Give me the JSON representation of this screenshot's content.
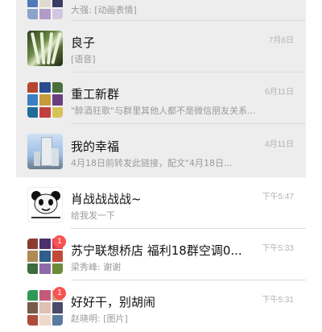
{
  "chats": [
    {
      "id": "partial-top",
      "title": "",
      "subtitle": "大强: [动画表情]",
      "time": ""
    },
    {
      "id": "liangzi",
      "title": "良子",
      "subtitle": "[语音]",
      "time": "7月6日"
    },
    {
      "id": "zhonggong",
      "title": "重工新群",
      "subtitle": "\"醉酒狂歌\"与群里其他人都不是微信朋友关系...",
      "time": "6月11日"
    },
    {
      "id": "xingfu",
      "title": "我的幸福",
      "subtitle": "4月18日前转发此链接，配文\"4月18日...",
      "time": "4月11日"
    },
    {
      "id": "xiaozhan",
      "title": "肖战战战战~",
      "subtitle": "给我发一下",
      "time": "下午5:47"
    },
    {
      "id": "suning",
      "title": "苏宁联想桥店  福利18群空调0...",
      "subtitle": "梁秀峰: 谢谢",
      "time": "下午5:33",
      "badge": "1"
    },
    {
      "id": "haohaogan",
      "title": "好好干，别胡闹",
      "subtitle": "赵晓明: [图片]",
      "time": "下午5:31",
      "badge": "1"
    }
  ],
  "colors": {
    "shaded_bg": "#ededed",
    "badge": "#fa5151",
    "title": "#111111",
    "subtitle": "#9b9b9b",
    "time": "#b2b2b2"
  },
  "icons": {
    "group_avatar": "group-avatar-icon",
    "panda_avatar": "panda-meme-avatar"
  }
}
